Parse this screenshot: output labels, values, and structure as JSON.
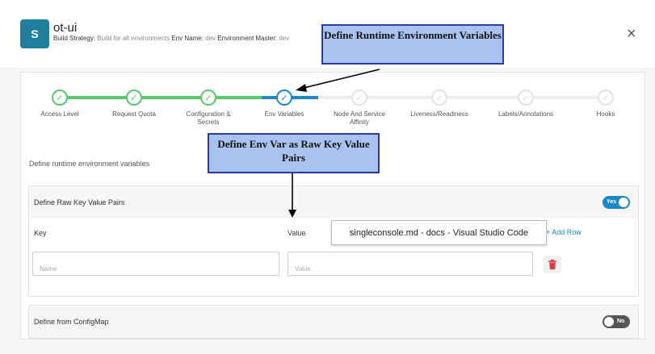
{
  "header": {
    "avatar_letter": "S",
    "app_name": "ot-ui",
    "build_strategy_label": "Build Strategy:",
    "build_strategy_value": "Build for all environments",
    "env_name_label": "Env Name:",
    "env_name_value": "dev",
    "env_master_label": "Environment Master:",
    "env_master_value": "dev",
    "close_icon": "×"
  },
  "stepper": {
    "steps": [
      {
        "label": "Access Level",
        "state": "done"
      },
      {
        "label": "Request Quota",
        "state": "done"
      },
      {
        "label": "Configuration & Secrets",
        "state": "done"
      },
      {
        "label": "Env Variables",
        "state": "active"
      },
      {
        "label": "Node And Service Affinity",
        "state": "todo"
      },
      {
        "label": "Liveness/Readiness",
        "state": "todo"
      },
      {
        "label": "Labels/Annotations",
        "state": "todo"
      },
      {
        "label": "Hooks",
        "state": "todo"
      }
    ],
    "check_glyph": "✓"
  },
  "description": "Define runtime environment variables",
  "raw_section": {
    "title": "Define Raw Key Value Pairs",
    "toggle_label": "Yes",
    "key_header": "Key",
    "value_header": "Value",
    "add_row": "+ Add Row",
    "key_placeholder": "Name",
    "value_placeholder": "Value"
  },
  "configmap_section": {
    "title": "Define from ConfigMap",
    "toggle_label": "No"
  },
  "tooltip": "singleconsole.md - docs - Visual Studio Code",
  "callouts": {
    "runtime": "Define Runtime Environment Variables",
    "rawkv": "Define Env Var as Raw Key Value Pairs"
  },
  "colors": {
    "done": "#58c96b",
    "active": "#1a88c9",
    "todo": "#e2e2e2",
    "delete": "#e23b3b",
    "callout_bg": "#a8c3f0",
    "callout_border": "#2a3ba8"
  },
  "icons": {
    "delete": "trash-icon",
    "close": "close-icon",
    "check": "check-icon"
  }
}
